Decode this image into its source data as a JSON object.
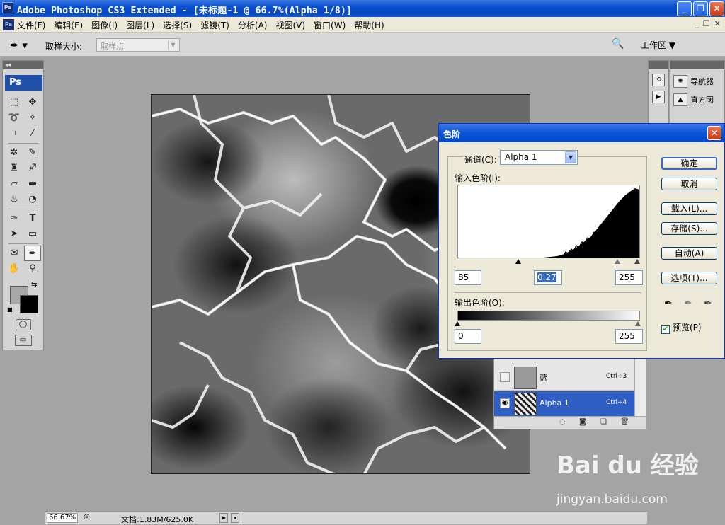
{
  "window": {
    "title": "Adobe Photoshop CS3 Extended - [未标题-1 @ 66.7%(Alpha 1/8)]",
    "app_icon": "Ps",
    "controls": [
      "_",
      "❐",
      "✕"
    ]
  },
  "menu": {
    "items": [
      "文件(F)",
      "编辑(E)",
      "图像(I)",
      "图层(L)",
      "选择(S)",
      "滤镜(T)",
      "分析(A)",
      "视图(V)",
      "窗口(W)",
      "帮助(H)"
    ],
    "doc_controls": [
      "_",
      "❐",
      "✕"
    ]
  },
  "options": {
    "tool_icon": "eyedropper-icon",
    "sample_size_label": "取样大小:",
    "sample_size_value": "取样点",
    "workspace_label": "工作区 ▼"
  },
  "toolbox": {
    "logo": "Ps"
  },
  "right_panels": {
    "navigator": "导航器",
    "histogram": "直方图"
  },
  "channels": {
    "rows": [
      {
        "name": "蓝",
        "shortcut": "Ctrl+3",
        "visible": false,
        "selected": false
      },
      {
        "name": "Alpha 1",
        "shortcut": "Ctrl+4",
        "visible": true,
        "selected": true
      }
    ]
  },
  "levels_dialog": {
    "title": "色阶",
    "channel_label": "通道(C):",
    "channel_value": "Alpha 1",
    "input_label": "输入色阶(I):",
    "input_black": "85",
    "input_gamma": "0.27",
    "input_white": "255",
    "output_label": "输出色阶(O):",
    "output_black": "0",
    "output_white": "255",
    "buttons": {
      "ok": "确定",
      "cancel": "取消",
      "load": "载入(L)...",
      "save": "存储(S)...",
      "auto": "自动(A)",
      "options": "选项(T)..."
    },
    "preview_label": "预览(P)",
    "preview_checked": true
  },
  "status": {
    "zoom": "66.67%",
    "doc_info": "文档:1.83M/625.0K"
  },
  "watermark": {
    "brand": "Bai du 经验",
    "url": "jingyan.baidu.com"
  }
}
